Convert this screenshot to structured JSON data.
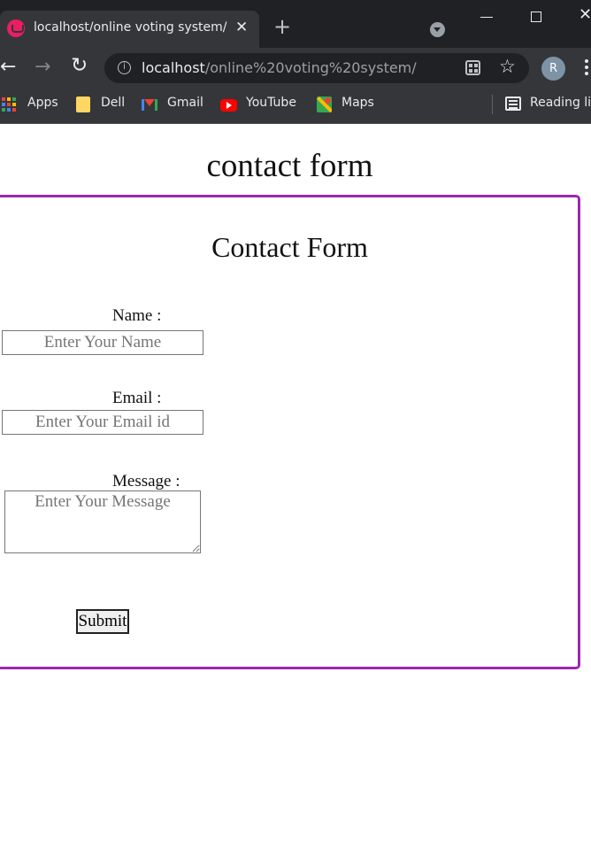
{
  "browser": {
    "tab_title": "localhost/online voting system/",
    "tab_close": "✕",
    "new_tab": "+",
    "url_host": "localhost",
    "url_path": "/online%20voting%20system/",
    "profile_initial": "R",
    "nav": {
      "back": "←",
      "forward": "→",
      "reload": "↻",
      "star": "☆",
      "window_close": "✕"
    },
    "bookmarks": [
      {
        "label": "Apps",
        "icon": "apps-grid-icon"
      },
      {
        "label": "Dell",
        "icon": "folder-icon"
      },
      {
        "label": "Gmail",
        "icon": "gmail-icon"
      },
      {
        "label": "YouTube",
        "icon": "youtube-icon"
      },
      {
        "label": "Maps",
        "icon": "maps-icon"
      }
    ],
    "reading_list": "Reading list"
  },
  "page": {
    "heading": "contact form",
    "form": {
      "title": "Contact Form",
      "name_label": "Name :",
      "name_placeholder": "Enter Your Name",
      "email_label": "Email :",
      "email_placeholder": "Enter Your Email id",
      "message_label": "Message :",
      "message_placeholder": "Enter Your Message",
      "submit_label": "Submit"
    }
  },
  "colors": {
    "form_border": "#9c27b0",
    "chrome_dark": "#202124",
    "chrome_toolbar": "#35363a"
  }
}
